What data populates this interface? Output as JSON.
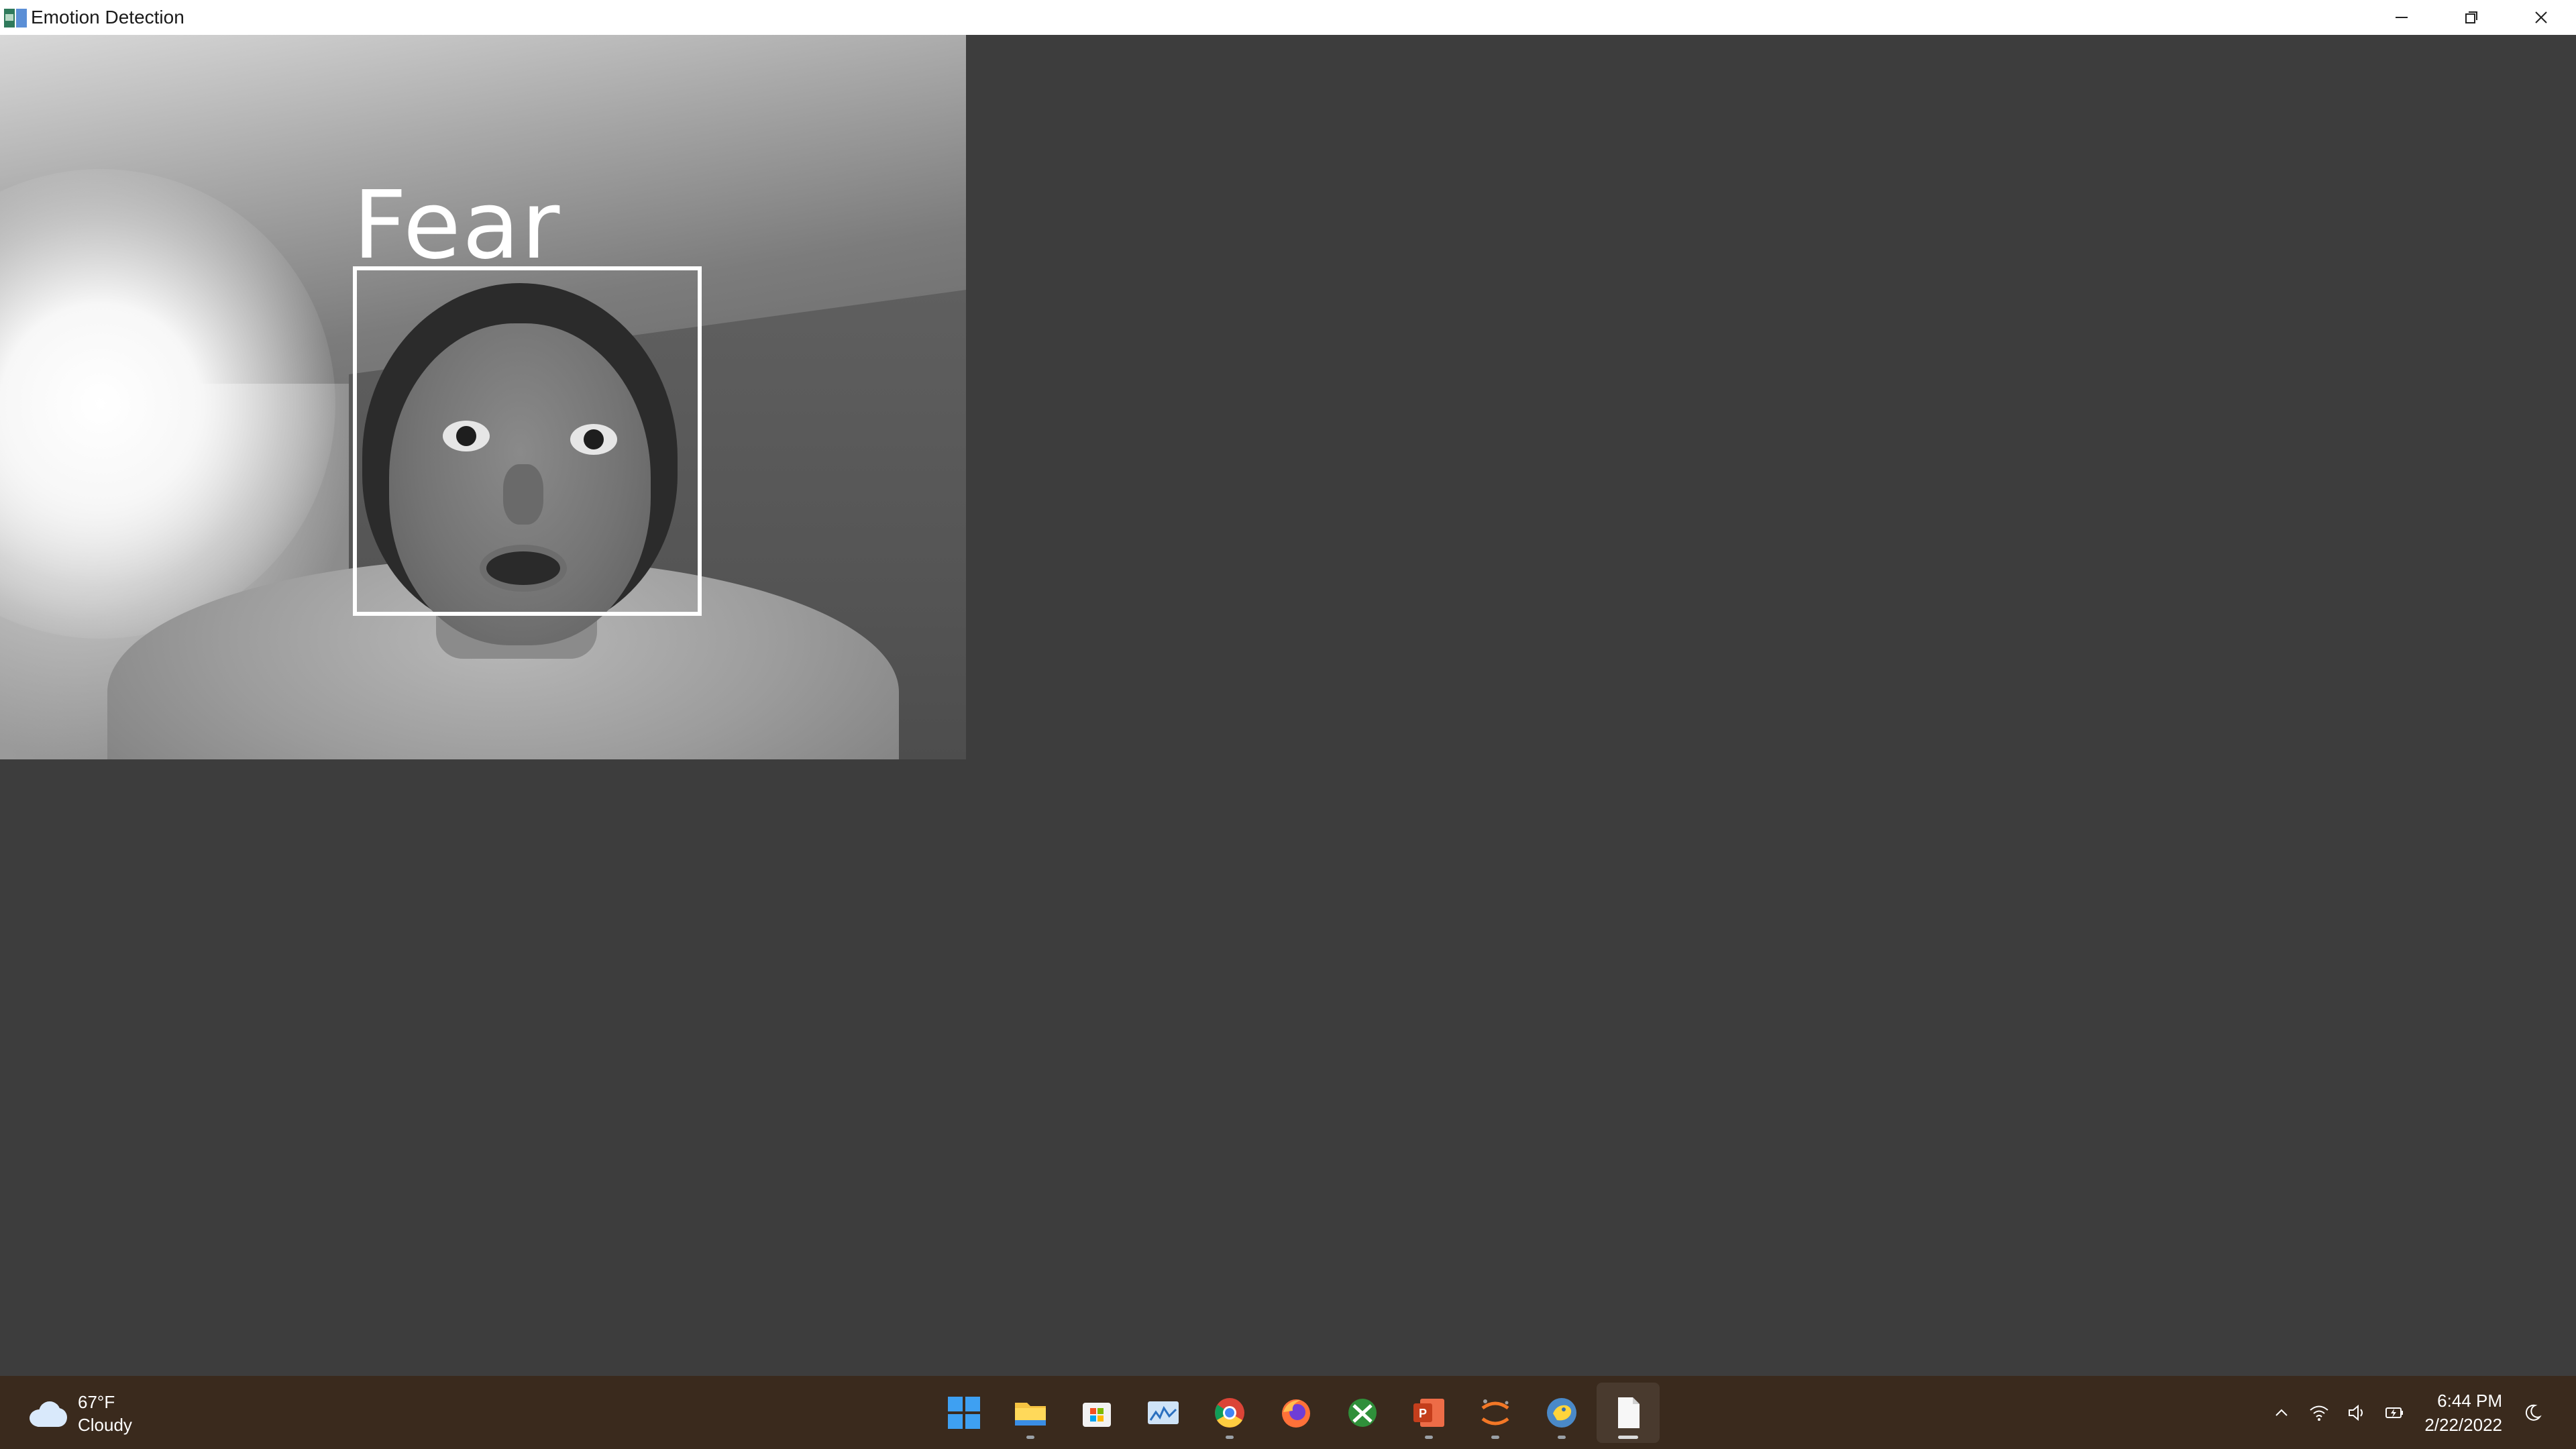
{
  "window": {
    "title": "Emotion Detection",
    "controls": [
      "minimize",
      "restore",
      "close"
    ]
  },
  "detection": {
    "label": "Fear"
  },
  "taskbar": {
    "weather": {
      "temperature": "67°F",
      "condition": "Cloudy",
      "icon": "cloud-icon"
    },
    "apps": [
      {
        "name": "start",
        "icon": "windows-start-icon"
      },
      {
        "name": "file-explorer",
        "icon": "folder-icon",
        "running": true
      },
      {
        "name": "microsoft-store",
        "icon": "store-icon"
      },
      {
        "name": "photos",
        "icon": "photos-icon"
      },
      {
        "name": "chrome",
        "icon": "chrome-icon",
        "running": true
      },
      {
        "name": "firefox",
        "icon": "firefox-icon"
      },
      {
        "name": "app-green",
        "icon": "app-icon"
      },
      {
        "name": "powerpoint",
        "icon": "powerpoint-icon",
        "running": true
      },
      {
        "name": "jupyter",
        "icon": "jupyter-icon",
        "running": true
      },
      {
        "name": "python-idle",
        "icon": "python-icon",
        "running": true
      },
      {
        "name": "emotion-detection-window",
        "icon": "document-icon",
        "active": true
      }
    ],
    "clock": {
      "time": "6:44 PM",
      "date": "2/22/2022"
    }
  }
}
